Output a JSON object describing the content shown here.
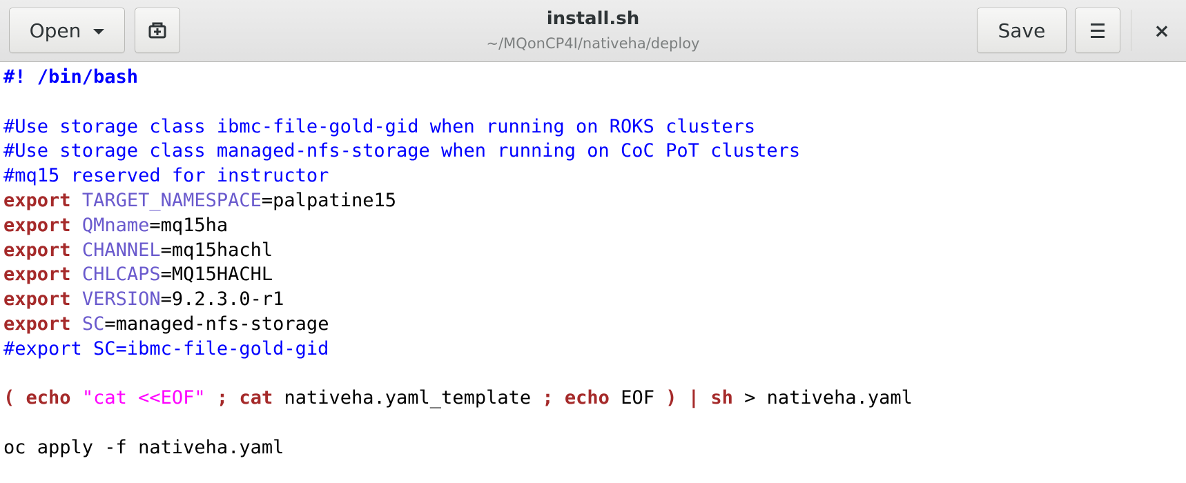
{
  "window": {
    "title": "install.sh",
    "subtitle": "~/MQonCP4I/nativeha/deploy"
  },
  "toolbar": {
    "open_label": "Open",
    "save_label": "Save",
    "new_tab_icon": "new-tab-icon",
    "menu_icon": "hamburger-menu-icon",
    "close_icon": "close-icon",
    "close_glyph": "×"
  },
  "colors": {
    "comment": "#0000ff",
    "keyword": "#a52a2a",
    "variable": "#6a5acd",
    "string": "#ff00ff",
    "text": "#000000"
  },
  "code": {
    "shebang": "#! /bin/bash",
    "comment1": "#Use storage class ibmc-file-gold-gid when running on ROKS clusters",
    "comment2": "#Use storage class managed-nfs-storage when running on CoC PoT clusters",
    "comment3": "#mq15 reserved for instructor",
    "exports": [
      {
        "kw": "export",
        "name": "TARGET_NAMESPACE",
        "value": "palpatine15"
      },
      {
        "kw": "export",
        "name": "QMname",
        "value": "mq15ha"
      },
      {
        "kw": "export",
        "name": "CHANNEL",
        "value": "mq15hachl"
      },
      {
        "kw": "export",
        "name": "CHLCAPS",
        "value": "MQ15HACHL"
      },
      {
        "kw": "export",
        "name": "VERSION",
        "value": "9.2.3.0-r1"
      },
      {
        "kw": "export",
        "name": "SC",
        "value": "managed-nfs-storage"
      }
    ],
    "comment4": "#export SC=ibmc-file-gold-gid",
    "pipeline": {
      "open_paren": "(",
      "echo1": "echo",
      "string1": "\"cat <<EOF\"",
      "semi1": ";",
      "cat": "cat",
      "cat_arg": "nativeha.yaml_template",
      "semi2": ";",
      "echo2": "echo",
      "echo2_arg": "EOF",
      "close_paren": ")",
      "pipe": "|",
      "sh": "sh",
      "redirect": "> nativeha.yaml"
    },
    "apply": "oc apply -f nativeha.yaml"
  }
}
